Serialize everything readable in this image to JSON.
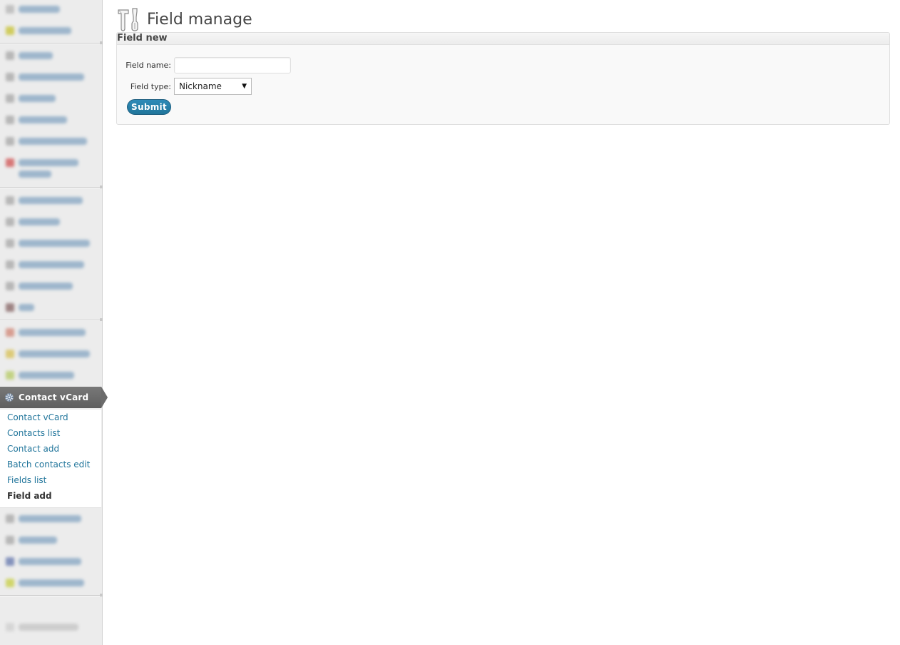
{
  "sidebar": {
    "current_menu": {
      "label": "Contact vCard",
      "icon": "gear-icon"
    },
    "submenu": [
      {
        "label": "Contact vCard"
      },
      {
        "label": "Contacts list"
      },
      {
        "label": "Contact add"
      },
      {
        "label": "Batch contacts edit"
      },
      {
        "label": "Fields list"
      },
      {
        "label": "Field add"
      }
    ],
    "current_submenu_index": 5
  },
  "page": {
    "title": "Field manage",
    "icon": "tools-icon"
  },
  "postbox": {
    "title": "Field new",
    "field_name_label": "Field name:",
    "field_name_value": "",
    "field_type_label": "Field type:",
    "field_type_value": "Nickname",
    "submit_label": "Submit"
  },
  "colors": {
    "link": "#21759b",
    "current_menu_bg": "#6b6b6b",
    "button": "#21759b"
  }
}
